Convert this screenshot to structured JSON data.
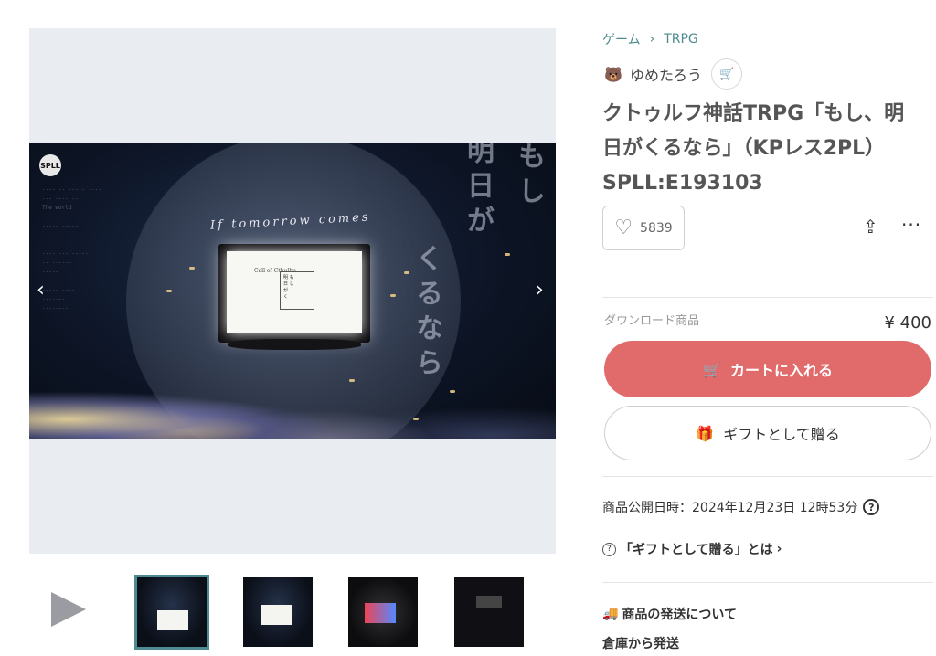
{
  "breadcrumb": {
    "category": "ゲーム",
    "subcategory": "TRPG"
  },
  "shop": {
    "name": "ゆめたろう"
  },
  "product": {
    "title": "クトゥルフ神話TRPG「もし、明日がくるなら」（KPレス2PL）SPLL:E193103",
    "likes": "5839",
    "type_label": "ダウンロード商品",
    "price": "¥ 400",
    "add_to_cart": "カートに入れる",
    "gift": "ギフトとして贈る",
    "published": "商品公開日時：2024年12月23日 12時53分",
    "gift_about": "「ギフトとして贈る」とは",
    "shipping_title": "商品の発送について",
    "shipping_from": "倉庫から発送"
  },
  "image": {
    "logo": "SPLL",
    "script_title": "If tomorrow comes",
    "screen_text": "Call of Cthulhu",
    "vertical_1": "くるなら",
    "vertical_2": "明日が",
    "vertical_3": "もし"
  },
  "icons": {
    "back": "‹",
    "forward": "›",
    "crumb_sep": "›",
    "heart": "♡",
    "share": "⇪",
    "more": "···",
    "cart": "🛒",
    "gift": "🎁",
    "help": "?",
    "about": "›",
    "truck": "🚚",
    "shop_icon": "🐻"
  }
}
